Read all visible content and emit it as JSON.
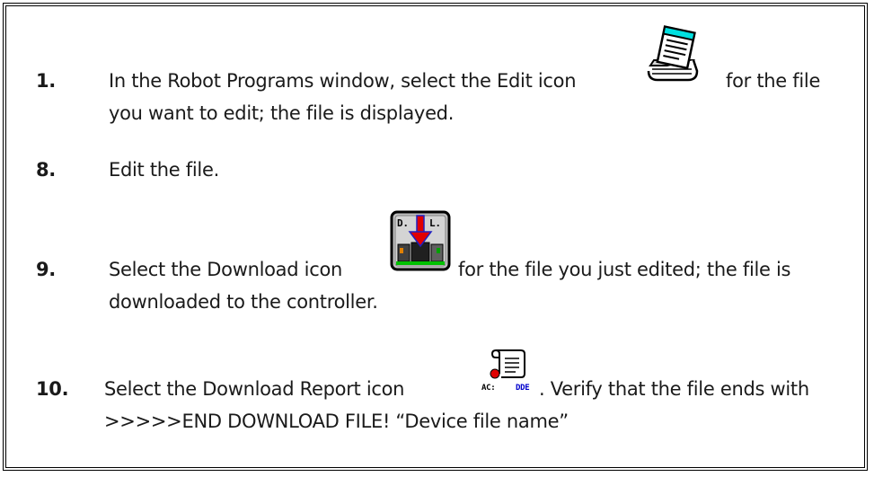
{
  "steps": [
    {
      "number": "1.",
      "text_before_icon": "In the Robot Programs window, select the Edit icon",
      "icon": "edit-notepad-icon",
      "text_after_icon": "for the file",
      "continuation": "you want to edit; the file is displayed."
    },
    {
      "number": "8.",
      "text": "Edit the file."
    },
    {
      "number": "9.",
      "text_before_icon": "Select the Download icon",
      "icon": "download-icon",
      "icon_labels": {
        "left": "D.",
        "right": "L."
      },
      "text_after_icon": "for the file you just edited; the file is",
      "continuation": "downloaded to the controller."
    },
    {
      "number": "10.",
      "text_before_icon": "Select the  Download Report icon",
      "icon": "download-report-icon",
      "icon_labels": {
        "left": "AC:",
        "right": "DDE"
      },
      "text_after_icon": ". Verify that the file ends with",
      "continuation": ">>>>>END DOWNLOAD FILE! “Device file name”"
    }
  ],
  "colors": {
    "border": "#000000",
    "text": "#1a1a1a",
    "edit_icon_cyan": "#00e0e0",
    "download_arrow": "#e00000",
    "download_bar": "#00c000",
    "report_label": "#0000cc"
  }
}
